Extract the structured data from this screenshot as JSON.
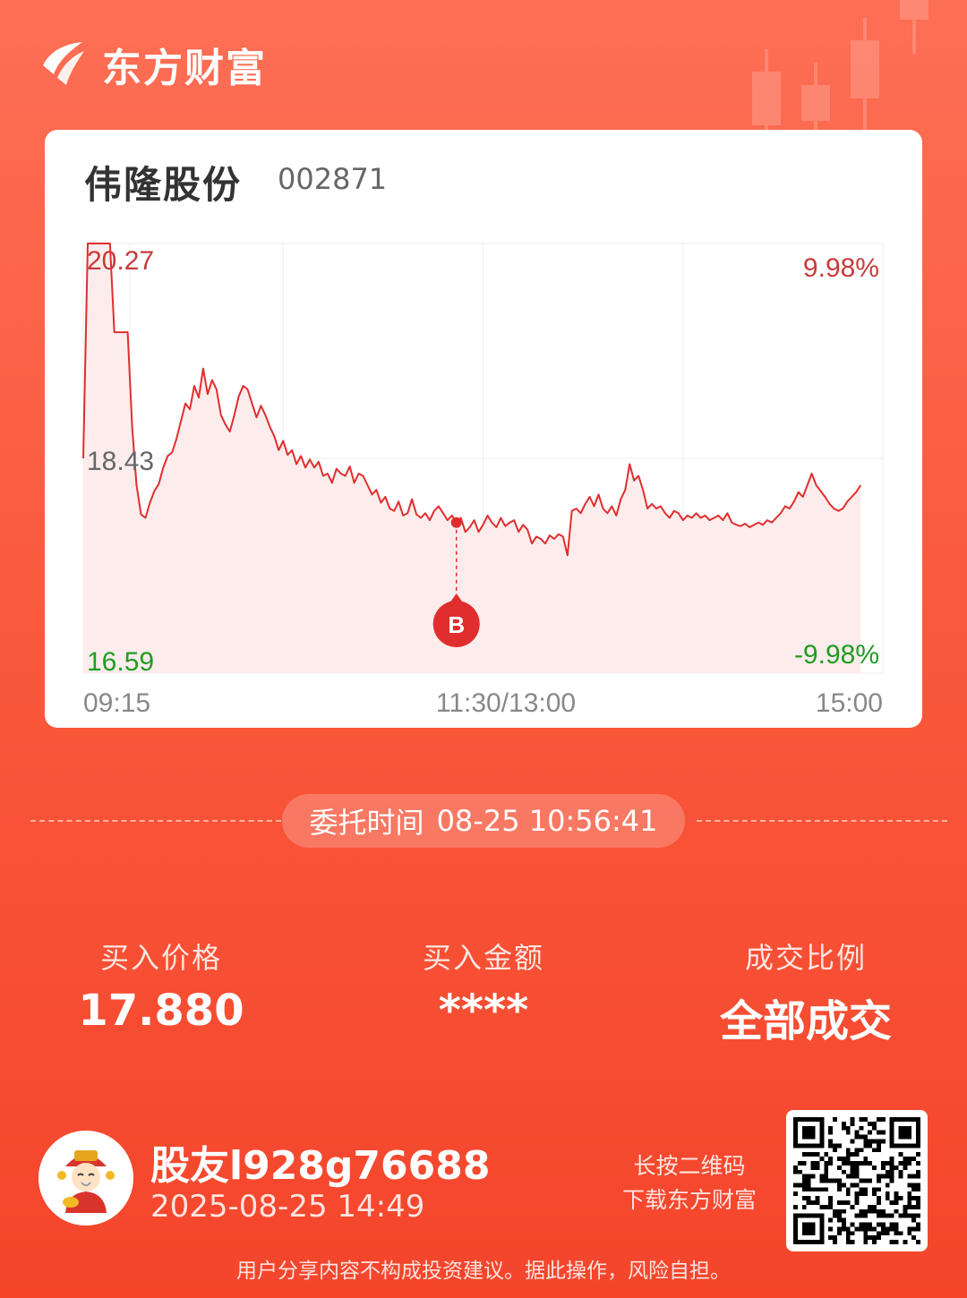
{
  "brand": {
    "name": "东方财富",
    "logo_icon": "eastmoney-logo-icon"
  },
  "stock": {
    "name": "伟隆股份",
    "code": "002871"
  },
  "chart_data": {
    "type": "line",
    "price_labels": {
      "high": "20.27",
      "mid": "18.43",
      "low": "16.59"
    },
    "pct_labels": {
      "high": "9.98%",
      "low": "-9.98%"
    },
    "x_ticks": [
      "09:15",
      "11:30/13:00",
      "15:00"
    ],
    "ylim": [
      16.59,
      20.27
    ],
    "colors": {
      "line": "#e02e2e",
      "up": "#c83b3b",
      "down": "#1f9d1f",
      "fill": "#fdecec"
    },
    "marker": {
      "label": "B",
      "time_index": 84,
      "price": 17.88
    },
    "series": [
      {
        "values": [
          18.43,
          20.27,
          20.27,
          20.27,
          20.27,
          20.27,
          20.27,
          19.51,
          19.51,
          19.51,
          19.51,
          18.7,
          18.2,
          17.95,
          17.92,
          18.05,
          18.15,
          18.21,
          18.35,
          18.45,
          18.48,
          18.6,
          18.75,
          18.9,
          18.85,
          19.05,
          18.95,
          19.2,
          18.98,
          19.1,
          19.02,
          18.8,
          18.72,
          18.66,
          18.8,
          18.96,
          19.05,
          19.02,
          18.9,
          18.78,
          18.88,
          18.8,
          18.7,
          18.62,
          18.5,
          18.58,
          18.46,
          18.5,
          18.38,
          18.45,
          18.35,
          18.42,
          18.35,
          18.4,
          18.28,
          18.3,
          18.22,
          18.34,
          18.3,
          18.28,
          18.36,
          18.22,
          18.3,
          18.28,
          18.2,
          18.12,
          18.16,
          18.05,
          18.1,
          18.0,
          17.98,
          18.06,
          17.94,
          17.96,
          18.08,
          17.95,
          17.92,
          17.96,
          17.9,
          17.98,
          18.02,
          17.96,
          17.9,
          17.94,
          17.88,
          17.92,
          17.8,
          17.84,
          17.9,
          17.8,
          17.86,
          17.94,
          17.88,
          17.84,
          17.92,
          17.85,
          17.88,
          17.9,
          17.8,
          17.86,
          17.82,
          17.7,
          17.76,
          17.74,
          17.7,
          17.77,
          17.74,
          17.78,
          17.76,
          17.6,
          17.98,
          18.0,
          17.96,
          18.04,
          18.1,
          18.02,
          18.12,
          18.0,
          17.96,
          18.02,
          17.94,
          18.08,
          18.16,
          18.38,
          18.24,
          18.28,
          18.16,
          18.0,
          18.04,
          18.0,
          18.02,
          17.96,
          17.92,
          17.98,
          17.96,
          17.9,
          17.94,
          17.92,
          17.96,
          17.92,
          17.94,
          17.9,
          17.92,
          17.94,
          17.9,
          17.96,
          17.88,
          17.86,
          17.85,
          17.87,
          17.84,
          17.86,
          17.88,
          17.86,
          17.9,
          17.88,
          17.92,
          17.96,
          18.02,
          18.0,
          18.06,
          18.14,
          18.1,
          18.2,
          18.3,
          18.2,
          18.15,
          18.1,
          18.04,
          18.0,
          17.98,
          18.0,
          18.06,
          18.1,
          18.14,
          18.2
        ]
      }
    ]
  },
  "order": {
    "time_label": "委托时间",
    "time_value": "08-25 10:56:41"
  },
  "stats": [
    {
      "label": "买入价格",
      "value": "17.880"
    },
    {
      "label": "买入金额",
      "value": "****"
    },
    {
      "label": "成交比例",
      "value": "全部成交"
    }
  ],
  "user": {
    "name": "股友l928g76688",
    "time": "2025-08-25 14:49",
    "avatar_icon": "caishen-avatar-icon"
  },
  "qr": {
    "hint_line1": "长按二维码",
    "hint_line2": "下载东方财富",
    "icon": "qr-code-icon"
  },
  "disclaimer": "用户分享内容不构成投资建议。据此操作，风险自担。"
}
